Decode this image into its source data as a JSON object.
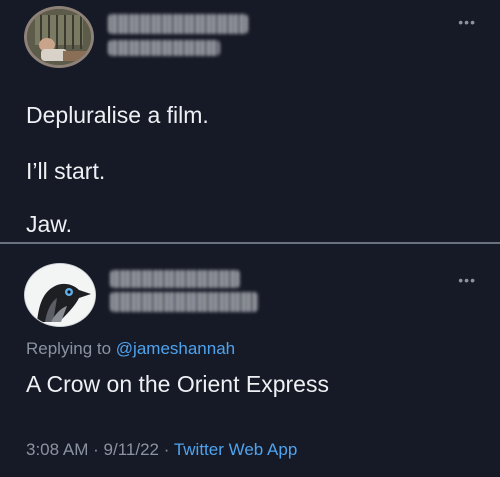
{
  "tweet": {
    "lines": [
      "Depluralise a film.",
      "I’ll start.",
      "Jaw."
    ],
    "more_icon": "more-dots-icon"
  },
  "reply": {
    "replying_prefix": "Replying to",
    "replying_handle": "@jameshannah",
    "text": "A Crow on the Orient Express",
    "time": "3:08 AM",
    "separator": "·",
    "date": "9/11/22",
    "source": "Twitter Web App",
    "more_icon": "more-dots-icon"
  },
  "colors": {
    "background": "#161a26",
    "text": "#eef0f3",
    "muted": "#8b92a0",
    "accent": "#4ea3ef"
  }
}
